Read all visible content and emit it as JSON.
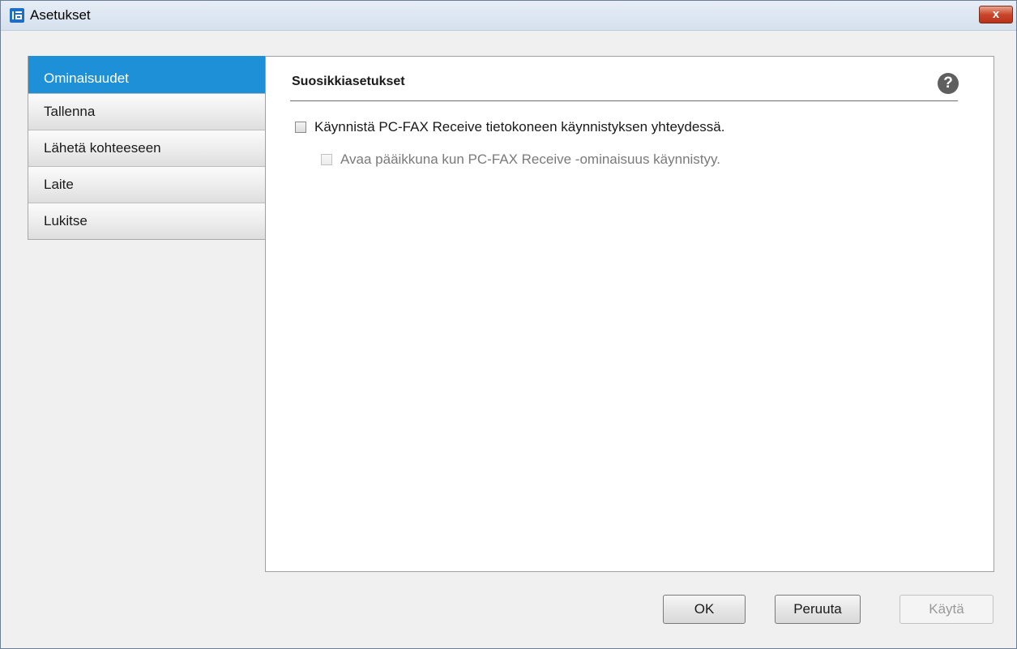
{
  "window": {
    "title": "Asetukset",
    "close_label": "x"
  },
  "sidebar": {
    "items": [
      {
        "label": "Ominaisuudet",
        "active": true
      },
      {
        "label": "Tallenna",
        "active": false
      },
      {
        "label": "Lähetä kohteeseen",
        "active": false
      },
      {
        "label": "Laite",
        "active": false
      },
      {
        "label": "Lukitse",
        "active": false
      }
    ]
  },
  "main": {
    "section_title": "Suosikkiasetukset",
    "help_label": "?",
    "options": [
      {
        "label": "Käynnistä PC-FAX Receive tietokoneen käynnistyksen yhteydessä.",
        "checked": false,
        "enabled": true
      },
      {
        "label": "Avaa pääikkuna kun PC-FAX Receive -ominaisuus käynnistyy.",
        "checked": false,
        "enabled": false
      }
    ]
  },
  "footer": {
    "ok_label": "OK",
    "cancel_label": "Peruuta",
    "apply_label": "Käytä"
  },
  "colors": {
    "accent": "#1e90d8",
    "close": "#c9462b"
  },
  "icons": {
    "app": "app-window-icon",
    "help": "help-icon",
    "close": "close-icon"
  }
}
